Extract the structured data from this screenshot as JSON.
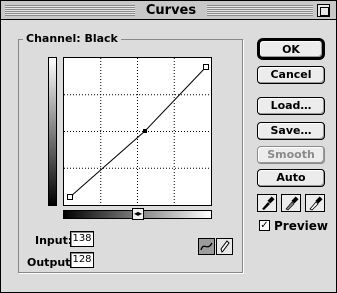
{
  "window": {
    "title": "Curves"
  },
  "channel": {
    "label": "Channel: Black"
  },
  "input": {
    "label": "Input:",
    "value": "138"
  },
  "output": {
    "label": "Output:",
    "value": "128"
  },
  "buttons": {
    "ok": "OK",
    "cancel": "Cancel",
    "load": "Load…",
    "save": "Save…",
    "smooth": "Smooth",
    "auto": "Auto"
  },
  "preview": {
    "label": "Preview",
    "checked": true
  },
  "icons": {
    "zoom": "zoom-box-icon",
    "curve_tool": "curve-tool-icon",
    "pencil_tool": "pencil-tool-icon",
    "black_eyedropper": "black-eyedropper-icon",
    "gray_eyedropper": "gray-eyedropper-icon",
    "white_eyedropper": "white-eyedropper-icon"
  }
}
